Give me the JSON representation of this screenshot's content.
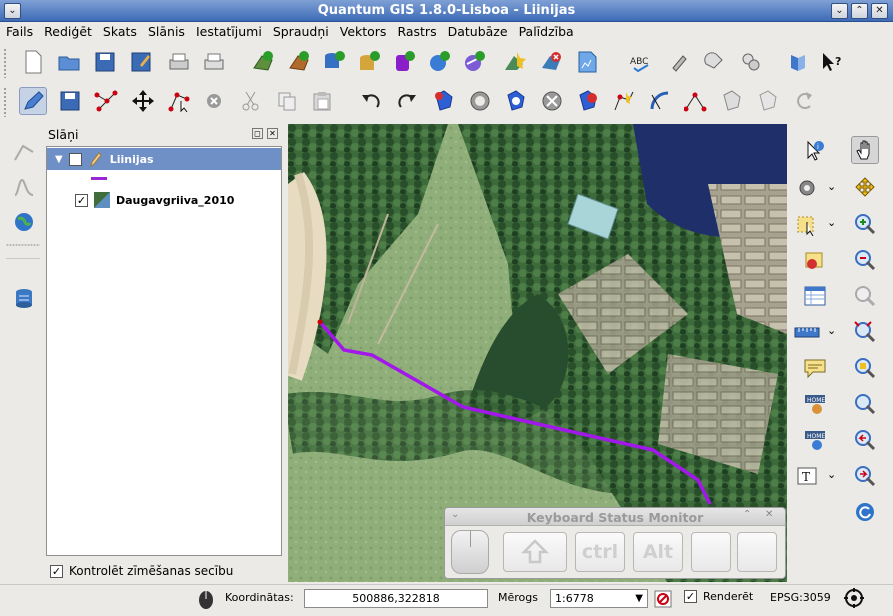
{
  "window": {
    "title": "Quantum GIS 1.8.0-Lisboa - Liinijas"
  },
  "menu": [
    "Fails",
    "Rediģēt",
    "Skats",
    "Slānis",
    "Iestatījumi",
    "Spraudņi",
    "Vektors",
    "Rastrs",
    "Datubāze",
    "Palīdzība"
  ],
  "layers_panel": {
    "title": "Slāņi",
    "layers": [
      {
        "name": "Liinijas",
        "checked": true,
        "selected": true,
        "color": "#9a26d6"
      },
      {
        "name": "Daugavgriiva_2010",
        "checked": true,
        "selected": false
      }
    ],
    "render_order_label": "Kontrolēt zīmēšanas secību"
  },
  "keyboard_monitor": {
    "title": "Keyboard Status Monitor",
    "keys": [
      "ctrl",
      "Alt"
    ]
  },
  "status": {
    "coords_label": "Koordinātas:",
    "coords_value": "500886,322818",
    "scale_label": "Mērogs",
    "scale_value": "1:6778",
    "render_label": "Renderēt",
    "crs": "EPSG:3059"
  },
  "colors": {
    "line": "#a218ea",
    "selection": "#6f8fc7",
    "title_bar": "#4f7bc4"
  }
}
